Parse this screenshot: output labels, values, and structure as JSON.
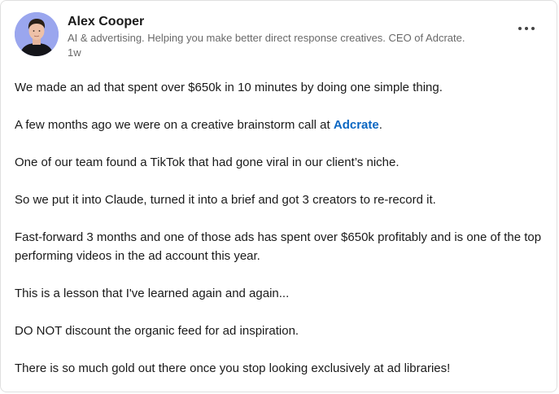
{
  "author": {
    "name": "Alex Cooper",
    "headline": "AI & advertising. Helping you make better direct response creatives. CEO of Adcrate.",
    "time": "1w",
    "avatar_bg": "#9aa6ee"
  },
  "menu": {
    "icon": "more-horizontal-icon"
  },
  "post": {
    "p1": "We made an ad that spent over $650k in 10 minutes by doing one simple thing.",
    "p2_prefix": "A few months ago we were on a creative brainstorm call at ",
    "p2_link": "Adcrate",
    "p2_suffix": ".",
    "p3": "One of our team found a TikTok that had gone viral in our client’s niche.",
    "p4": "So we put it into Claude, turned it into a brief and got 3 creators to re-record it.",
    "p5": "Fast-forward 3 months and one of those ads has spent over $650k profitably and is one of the top performing videos in the ad account this year.",
    "p6": "This is a lesson that I've learned again and again...",
    "p7": "DO NOT discount the organic feed for ad inspiration.",
    "p8": "There is so much gold out there once you stop looking exclusively at ad libraries!"
  },
  "colors": {
    "link": "#0a66c2",
    "text": "rgba(0,0,0,0.9)",
    "muted": "rgba(0,0,0,0.6)"
  }
}
